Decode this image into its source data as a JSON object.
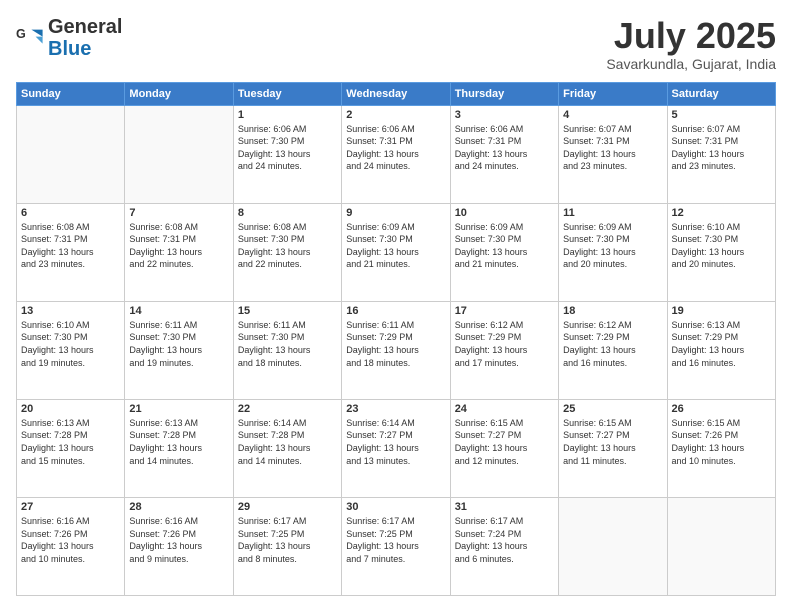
{
  "header": {
    "logo_general": "General",
    "logo_blue": "Blue",
    "month_title": "July 2025",
    "location": "Savarkundla, Gujarat, India"
  },
  "weekdays": [
    "Sunday",
    "Monday",
    "Tuesday",
    "Wednesday",
    "Thursday",
    "Friday",
    "Saturday"
  ],
  "weeks": [
    [
      {
        "day": "",
        "info": ""
      },
      {
        "day": "",
        "info": ""
      },
      {
        "day": "1",
        "info": "Sunrise: 6:06 AM\nSunset: 7:30 PM\nDaylight: 13 hours\nand 24 minutes."
      },
      {
        "day": "2",
        "info": "Sunrise: 6:06 AM\nSunset: 7:31 PM\nDaylight: 13 hours\nand 24 minutes."
      },
      {
        "day": "3",
        "info": "Sunrise: 6:06 AM\nSunset: 7:31 PM\nDaylight: 13 hours\nand 24 minutes."
      },
      {
        "day": "4",
        "info": "Sunrise: 6:07 AM\nSunset: 7:31 PM\nDaylight: 13 hours\nand 23 minutes."
      },
      {
        "day": "5",
        "info": "Sunrise: 6:07 AM\nSunset: 7:31 PM\nDaylight: 13 hours\nand 23 minutes."
      }
    ],
    [
      {
        "day": "6",
        "info": "Sunrise: 6:08 AM\nSunset: 7:31 PM\nDaylight: 13 hours\nand 23 minutes."
      },
      {
        "day": "7",
        "info": "Sunrise: 6:08 AM\nSunset: 7:31 PM\nDaylight: 13 hours\nand 22 minutes."
      },
      {
        "day": "8",
        "info": "Sunrise: 6:08 AM\nSunset: 7:30 PM\nDaylight: 13 hours\nand 22 minutes."
      },
      {
        "day": "9",
        "info": "Sunrise: 6:09 AM\nSunset: 7:30 PM\nDaylight: 13 hours\nand 21 minutes."
      },
      {
        "day": "10",
        "info": "Sunrise: 6:09 AM\nSunset: 7:30 PM\nDaylight: 13 hours\nand 21 minutes."
      },
      {
        "day": "11",
        "info": "Sunrise: 6:09 AM\nSunset: 7:30 PM\nDaylight: 13 hours\nand 20 minutes."
      },
      {
        "day": "12",
        "info": "Sunrise: 6:10 AM\nSunset: 7:30 PM\nDaylight: 13 hours\nand 20 minutes."
      }
    ],
    [
      {
        "day": "13",
        "info": "Sunrise: 6:10 AM\nSunset: 7:30 PM\nDaylight: 13 hours\nand 19 minutes."
      },
      {
        "day": "14",
        "info": "Sunrise: 6:11 AM\nSunset: 7:30 PM\nDaylight: 13 hours\nand 19 minutes."
      },
      {
        "day": "15",
        "info": "Sunrise: 6:11 AM\nSunset: 7:30 PM\nDaylight: 13 hours\nand 18 minutes."
      },
      {
        "day": "16",
        "info": "Sunrise: 6:11 AM\nSunset: 7:29 PM\nDaylight: 13 hours\nand 18 minutes."
      },
      {
        "day": "17",
        "info": "Sunrise: 6:12 AM\nSunset: 7:29 PM\nDaylight: 13 hours\nand 17 minutes."
      },
      {
        "day": "18",
        "info": "Sunrise: 6:12 AM\nSunset: 7:29 PM\nDaylight: 13 hours\nand 16 minutes."
      },
      {
        "day": "19",
        "info": "Sunrise: 6:13 AM\nSunset: 7:29 PM\nDaylight: 13 hours\nand 16 minutes."
      }
    ],
    [
      {
        "day": "20",
        "info": "Sunrise: 6:13 AM\nSunset: 7:28 PM\nDaylight: 13 hours\nand 15 minutes."
      },
      {
        "day": "21",
        "info": "Sunrise: 6:13 AM\nSunset: 7:28 PM\nDaylight: 13 hours\nand 14 minutes."
      },
      {
        "day": "22",
        "info": "Sunrise: 6:14 AM\nSunset: 7:28 PM\nDaylight: 13 hours\nand 14 minutes."
      },
      {
        "day": "23",
        "info": "Sunrise: 6:14 AM\nSunset: 7:27 PM\nDaylight: 13 hours\nand 13 minutes."
      },
      {
        "day": "24",
        "info": "Sunrise: 6:15 AM\nSunset: 7:27 PM\nDaylight: 13 hours\nand 12 minutes."
      },
      {
        "day": "25",
        "info": "Sunrise: 6:15 AM\nSunset: 7:27 PM\nDaylight: 13 hours\nand 11 minutes."
      },
      {
        "day": "26",
        "info": "Sunrise: 6:15 AM\nSunset: 7:26 PM\nDaylight: 13 hours\nand 10 minutes."
      }
    ],
    [
      {
        "day": "27",
        "info": "Sunrise: 6:16 AM\nSunset: 7:26 PM\nDaylight: 13 hours\nand 10 minutes."
      },
      {
        "day": "28",
        "info": "Sunrise: 6:16 AM\nSunset: 7:26 PM\nDaylight: 13 hours\nand 9 minutes."
      },
      {
        "day": "29",
        "info": "Sunrise: 6:17 AM\nSunset: 7:25 PM\nDaylight: 13 hours\nand 8 minutes."
      },
      {
        "day": "30",
        "info": "Sunrise: 6:17 AM\nSunset: 7:25 PM\nDaylight: 13 hours\nand 7 minutes."
      },
      {
        "day": "31",
        "info": "Sunrise: 6:17 AM\nSunset: 7:24 PM\nDaylight: 13 hours\nand 6 minutes."
      },
      {
        "day": "",
        "info": ""
      },
      {
        "day": "",
        "info": ""
      }
    ]
  ]
}
